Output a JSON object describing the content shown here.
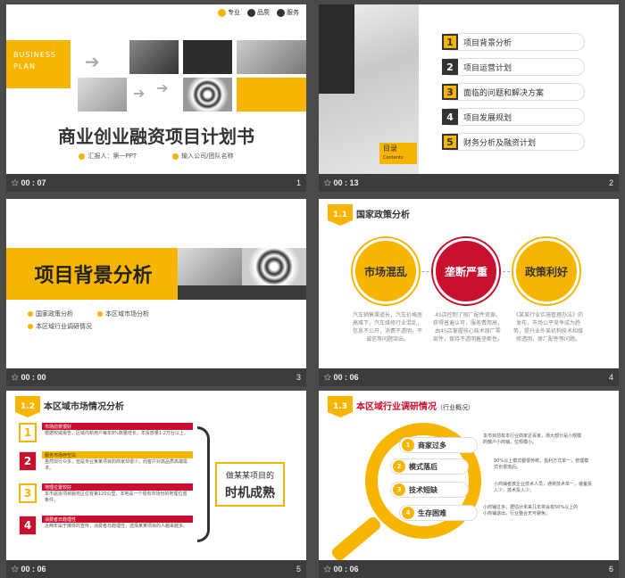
{
  "slides": [
    {
      "number": "1",
      "time": "00 : 07",
      "tags": [
        "专业",
        "品质",
        "服务"
      ],
      "left_block": [
        "BUSINESS",
        "PLAN"
      ],
      "title": "商业创业融资项目计划书",
      "reporter": "汇报人：第一PPT",
      "company": "输入公司/团队名称"
    },
    {
      "number": "2",
      "time": "00 : 13",
      "catalog": "目录",
      "catalog_en": "Contents",
      "items": [
        {
          "num": "1",
          "label": "项目背景分析"
        },
        {
          "num": "2",
          "label": "项目运营计划"
        },
        {
          "num": "3",
          "label": "面临的问题和解决方案"
        },
        {
          "num": "4",
          "label": "项目发展规划"
        },
        {
          "num": "5",
          "label": "财务分析及融资计划"
        }
      ]
    },
    {
      "number": "3",
      "time": "00 : 00",
      "title": "项目背景分析",
      "bullets": [
        "国家政策分析",
        "本区域市场分析",
        "本区域行业调研情况"
      ]
    },
    {
      "number": "4",
      "time": "00 : 06",
      "section": "1.1",
      "heading": "国家政策分析",
      "circles": [
        "市场混乱",
        "垄断严重",
        "政策利好"
      ],
      "desc": [
        "汽车销售渠道长，汽车价格居高难下，汽车维修行业混乱，信息不公开，消费不透明，不诚信等问题突出。",
        "4S店控制了原厂配件资源，获得普遍认可，服务费用高，由4S店掌握核心技术原厂零部件，保持不透明着垄断性。",
        "《某某行业实施管理办法》的发布，市场公平竞争成为趋势，提升业外某机构技术和维修透明，原厂配件等问题。"
      ]
    },
    {
      "number": "5",
      "time": "00 : 06",
      "section": "1.2",
      "heading": "本区域市场情况分析",
      "rows": [
        {
          "num": "1",
          "head": "市场前景很好",
          "text": "根据权威报告，区域内新用户每年8%数量增长，年投放量1.2万台以上。"
        },
        {
          "num": "2",
          "head": "服务市场存空白",
          "text": "虽然现行众多，但是专业某某项目的商家却很少，而客户对高品质高端需求。"
        },
        {
          "num": "3",
          "head": "地理位置较好",
          "text": "本市驱逐项目服务区位有第120公里，本地是一个很有市场份的地理位置条件。"
        },
        {
          "num": "4",
          "head": "消费者日趋理性",
          "text": "近两年由于媒体的宣传，消费者日趋理性，选择某某项目的人越来越多。"
        }
      ],
      "conclusion_1": "做某某项目的",
      "conclusion_2": "时机成熟"
    },
    {
      "number": "6",
      "time": "00 : 06",
      "section": "1.3",
      "heading": "本区域行业调研情况",
      "sub_heading": "（行业概况）",
      "items": [
        {
          "num": "1",
          "label": "商家过多",
          "desc": "本市目前有本行业商家近百家，场大部分是小规模的散户小商铺，位规模小。"
        },
        {
          "num": "2",
          "label": "模式落后",
          "desc": "90%以上模式都很传统，盈利方式单一，管理模式也很落后。"
        },
        {
          "num": "3",
          "label": "技术短缺",
          "desc": "小商铺者按企业技术人员，通常技术单一，装备投入少，技术投入少。"
        },
        {
          "num": "4",
          "label": "生存困难",
          "desc": "小商铺过多，据估计未来几年将会有50%以上的小商铺退出，行业整合无可避免。"
        }
      ]
    }
  ],
  "colors": {
    "accent": "#f7b500",
    "red": "#c8102e",
    "dark": "#333333"
  }
}
